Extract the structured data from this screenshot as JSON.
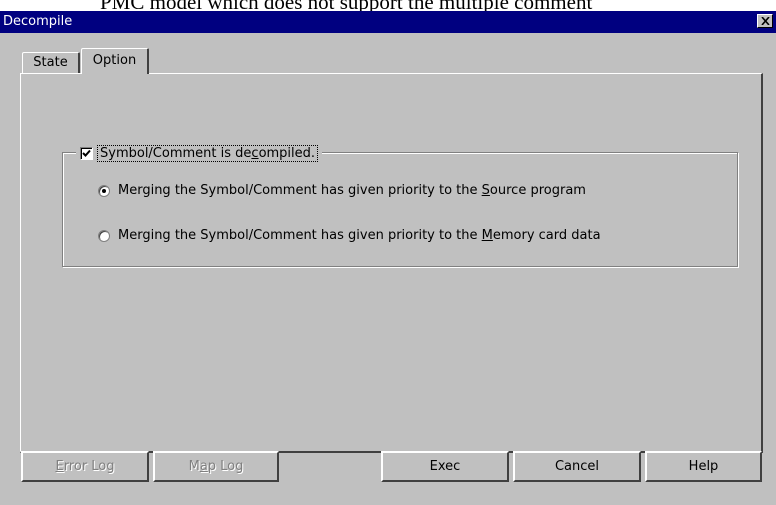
{
  "background_text": "PMC model which does not support the multiple comment",
  "window": {
    "title": "Decompile"
  },
  "tabs": [
    {
      "label": "State",
      "active": false
    },
    {
      "label": "Option",
      "active": true
    }
  ],
  "option_group": {
    "checkbox": {
      "label_pre": "Symbol/Comment is de",
      "label_key": "c",
      "label_post": "ompiled.",
      "checked": true
    },
    "radios": [
      {
        "label_pre": "Merging the Symbol/Comment has given priority to the ",
        "label_key": "S",
        "label_post": "ource program",
        "selected": true
      },
      {
        "label_pre": "Merging the Symbol/Comment has given priority to the ",
        "label_key": "M",
        "label_post": "emory card data",
        "selected": false
      }
    ]
  },
  "buttons": {
    "error_log": {
      "key": "E",
      "rest": "rror Log",
      "enabled": false
    },
    "map_log": {
      "pre": "M",
      "key": "a",
      "rest": "p Log",
      "enabled": false
    },
    "exec": "Exec",
    "cancel": "Cancel",
    "help": "Help"
  }
}
